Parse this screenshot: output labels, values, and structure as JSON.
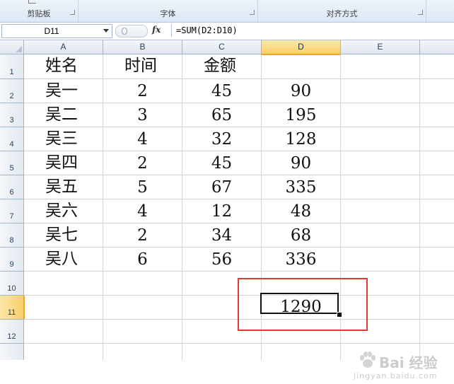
{
  "ribbon": {
    "groups": [
      {
        "label": "剪贴板"
      },
      {
        "label": "字体"
      },
      {
        "label": "对齐方式"
      }
    ]
  },
  "formula_bar": {
    "name_box": "D11",
    "fx_label": "fx",
    "formula": "=SUM(D2:D10)"
  },
  "sheet": {
    "columns": [
      "A",
      "B",
      "C",
      "D",
      "E"
    ],
    "selected_column": "D",
    "rows": [
      "1",
      "2",
      "3",
      "4",
      "5",
      "6",
      "7",
      "8",
      "9",
      "10",
      "11",
      "12"
    ],
    "selected_row": "11",
    "header_row": {
      "a": "姓名",
      "b": "时间",
      "c": "金额",
      "d": ""
    },
    "data_rows": [
      {
        "a": "吴一",
        "b": "2",
        "c": "45",
        "d": "90"
      },
      {
        "a": "吴二",
        "b": "3",
        "c": "65",
        "d": "195"
      },
      {
        "a": "吴三",
        "b": "4",
        "c": "32",
        "d": "128"
      },
      {
        "a": "吴四",
        "b": "2",
        "c": "45",
        "d": "90"
      },
      {
        "a": "吴五",
        "b": "5",
        "c": "67",
        "d": "335"
      },
      {
        "a": "吴六",
        "b": "4",
        "c": "12",
        "d": "48"
      },
      {
        "a": "吴七",
        "b": "2",
        "c": "34",
        "d": "68"
      },
      {
        "a": "吴八",
        "b": "6",
        "c": "56",
        "d": "336"
      }
    ],
    "total_cell": {
      "ref": "D11",
      "value": "1290"
    }
  },
  "watermark": {
    "text": "Bai 经验",
    "sub": "jingyan.baidu.com"
  },
  "colors": {
    "highlight_border": "#e53935",
    "selected_header": "#f8cf6a"
  }
}
